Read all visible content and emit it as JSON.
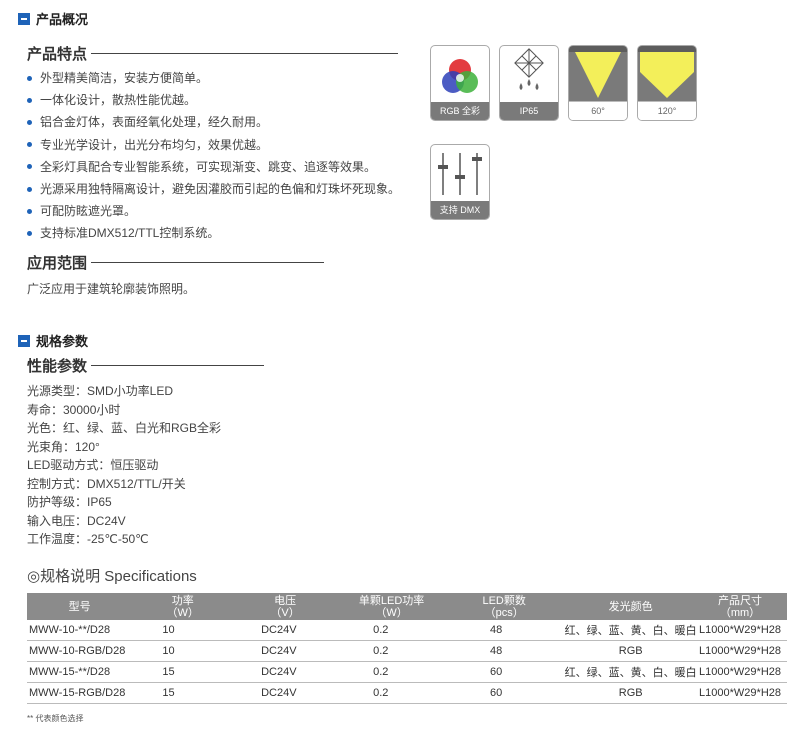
{
  "overview": {
    "title": "产品概况"
  },
  "features": {
    "title": "产品特点",
    "items": [
      "外型精美简洁，安装方便简单。",
      "一体化设计，散热性能优越。",
      "铝合金灯体，表面经氧化处理，经久耐用。",
      "专业光学设计，出光分布均匀，效果优越。",
      "全彩灯具配合专业智能系统，可实现渐变、跳变、追逐等效果。",
      "光源采用独特隔离设计，避免因灌胶而引起的色偏和灯珠坏死现象。",
      "可配防眩遮光罩。",
      "支持标准DMX512/TTL控制系统。"
    ]
  },
  "icons": {
    "rgb": "RGB 全彩",
    "ip": "IP65",
    "beam60": "60°",
    "beam120": "120°",
    "dmx": "支持 DMX"
  },
  "application": {
    "title": "应用范围",
    "text": "广泛应用于建筑轮廓装饰照明。"
  },
  "specs_section": {
    "title": "规格参数"
  },
  "performance": {
    "title": "性能参数",
    "lines": [
      "光源类型：SMD小功率LED",
      "寿命：30000小时",
      "光色：红、绿、蓝、白光和RGB全彩",
      "光束角：120°",
      "LED驱动方式：恒压驱动",
      "控制方式：DMX512/TTL/开关",
      "防护等级：IP65",
      "输入电压：DC24V",
      "工作温度：-25℃-50℃"
    ]
  },
  "spec_table": {
    "title": "◎规格说明 Specifications",
    "headers": [
      {
        "main": "型号",
        "sub": ""
      },
      {
        "main": "功率",
        "sub": "（W）"
      },
      {
        "main": "电压",
        "sub": "（V）"
      },
      {
        "main": "单颗LED功率",
        "sub": "（W）"
      },
      {
        "main": "LED颗数",
        "sub": "（pcs）"
      },
      {
        "main": "发光颜色",
        "sub": ""
      },
      {
        "main": "产品尺寸",
        "sub": "（mm）"
      }
    ],
    "rows": [
      [
        "MWW-10-**/D28",
        "10",
        "DC24V",
        "0.2",
        "48",
        "红、绿、蓝、黄、白、暖白",
        "L1000*W29*H28"
      ],
      [
        "MWW-10-RGB/D28",
        "10",
        "DC24V",
        "0.2",
        "48",
        "RGB",
        "L1000*W29*H28"
      ],
      [
        "MWW-15-**/D28",
        "15",
        "DC24V",
        "0.2",
        "60",
        "红、绿、蓝、黄、白、暖白",
        "L1000*W29*H28"
      ],
      [
        "MWW-15-RGB/D28",
        "15",
        "DC24V",
        "0.2",
        "60",
        "RGB",
        "L1000*W29*H28"
      ]
    ],
    "note": "** 代表颜色选择"
  },
  "colors": {
    "accent": "#1e63b8",
    "table_header": "#8b8b8b",
    "beam_yellow": "#f3ef5a"
  }
}
